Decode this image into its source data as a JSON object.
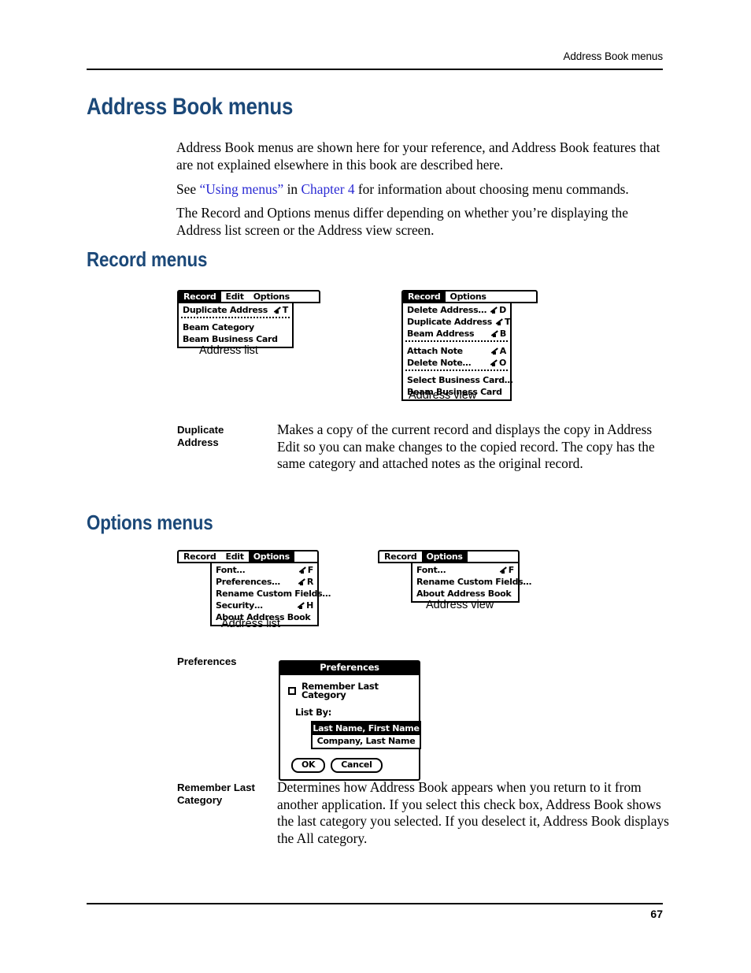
{
  "page": {
    "running_head": "Address Book menus",
    "folio": "67",
    "heading_color": "#1b4878",
    "link_color": "#2b2bd4"
  },
  "chapter": {
    "title": "Address Book menus",
    "paragraphs": {
      "p1": "Address Book menus are shown here for your reference, and Address Book features that are not explained elsewhere in this book are described here.",
      "p2_pre": "See ",
      "p2_link1": "“Using menus”",
      "p2_mid": " in ",
      "p2_link2": "Chapter 4",
      "p2_post": " for information about choosing menu commands.",
      "p3": "The Record and Options menus differ depending on whether you’re displaying the Address list screen or the Address view screen."
    }
  },
  "record_section": {
    "title": "Record menus",
    "list_menu": {
      "caption": "Address list",
      "menubar": [
        {
          "label": "Record",
          "selected": true
        },
        {
          "label": "Edit",
          "selected": false
        },
        {
          "label": "Options",
          "selected": false
        }
      ],
      "groups": [
        [
          {
            "label": "Duplicate Address",
            "shortcut": "T"
          }
        ],
        [
          {
            "label": "Beam Category",
            "shortcut": ""
          },
          {
            "label": "Beam Business Card",
            "shortcut": ""
          }
        ]
      ]
    },
    "view_menu": {
      "caption": "Address view",
      "menubar": [
        {
          "label": "Record",
          "selected": true
        },
        {
          "label": "Options",
          "selected": false
        }
      ],
      "groups": [
        [
          {
            "label": "Delete Address…",
            "shortcut": "D"
          },
          {
            "label": "Duplicate Address",
            "shortcut": "T"
          },
          {
            "label": "Beam Address",
            "shortcut": "B"
          }
        ],
        [
          {
            "label": "Attach Note",
            "shortcut": "A"
          },
          {
            "label": "Delete Note…",
            "shortcut": "O"
          }
        ],
        [
          {
            "label": "Select Business Card…",
            "shortcut": ""
          },
          {
            "label": "Beam Business Card",
            "shortcut": ""
          }
        ]
      ]
    },
    "definition": {
      "term_line1": "Duplicate",
      "term_line2": "Address",
      "body": "Makes a copy of the current record and displays the copy in Address Edit so you can make changes to the copied record. The copy has the same category and attached notes as the original record."
    }
  },
  "options_section": {
    "title": "Options menus",
    "list_menu": {
      "caption": "Address list",
      "menubar": [
        {
          "label": "Record",
          "selected": false
        },
        {
          "label": "Edit",
          "selected": false
        },
        {
          "label": "Options",
          "selected": true
        }
      ],
      "groups": [
        [
          {
            "label": "Font…",
            "shortcut": "F"
          },
          {
            "label": "Preferences…",
            "shortcut": "R"
          },
          {
            "label": "Rename Custom Fields…",
            "shortcut": ""
          },
          {
            "label": "Security…",
            "shortcut": "H"
          },
          {
            "label": "About Address Book",
            "shortcut": ""
          }
        ]
      ]
    },
    "view_menu": {
      "caption": "Address view",
      "menubar": [
        {
          "label": "Record",
          "selected": false
        },
        {
          "label": "Options",
          "selected": true
        }
      ],
      "groups": [
        [
          {
            "label": "Font…",
            "shortcut": "F"
          },
          {
            "label": "Rename Custom Fields…",
            "shortcut": ""
          },
          {
            "label": "About Address Book",
            "shortcut": ""
          }
        ]
      ]
    },
    "preferences_label": "Preferences",
    "dialog": {
      "title": "Preferences",
      "checkbox_label": "Remember Last Category",
      "checkbox_checked": false,
      "list_by_label": "List By:",
      "options": [
        {
          "label": "Last Name, First Name",
          "selected": true
        },
        {
          "label": "Company, Last Name",
          "selected": false
        }
      ],
      "ok_label": "OK",
      "cancel_label": "Cancel"
    },
    "definition": {
      "term_line1": "Remember Last",
      "term_line2": "Category",
      "body": "Determines how Address Book appears when you return to it from another application. If you select this check box, Address Book shows the last category you selected. If you deselect it, Address Book displays the All category."
    }
  }
}
